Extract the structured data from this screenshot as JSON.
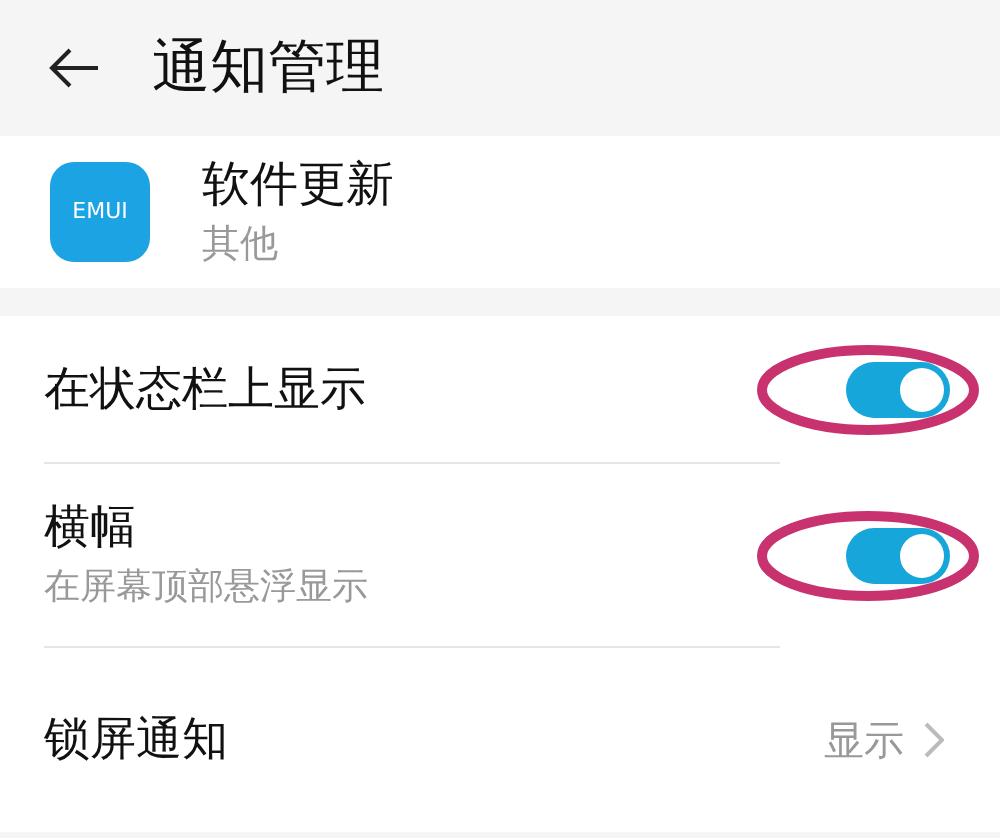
{
  "header": {
    "title": "通知管理"
  },
  "app": {
    "icon_text": "EMUI",
    "name": "软件更新",
    "category": "其他"
  },
  "settings": [
    {
      "kind": "toggle",
      "title": "在状态栏上显示",
      "on": true,
      "highlighted": true
    },
    {
      "kind": "toggle",
      "title": "横幅",
      "subtitle": "在屏幕顶部悬浮显示",
      "on": true,
      "highlighted": true
    },
    {
      "kind": "link",
      "title": "锁屏通知",
      "value": "显示"
    }
  ]
}
